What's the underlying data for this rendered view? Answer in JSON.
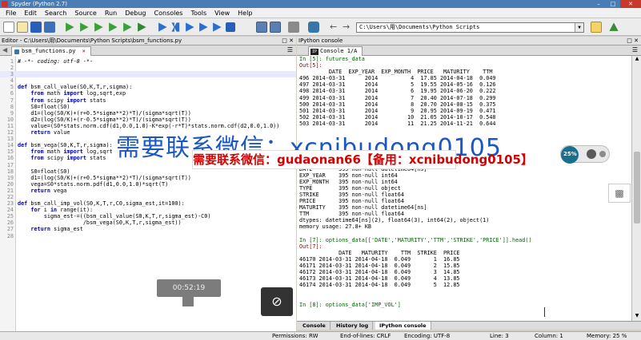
{
  "window": {
    "title": "Spyder (Python 2.7)"
  },
  "menu": [
    "File",
    "Edit",
    "Search",
    "Source",
    "Run",
    "Debug",
    "Consoles",
    "Tools",
    "View",
    "Help"
  ],
  "toolbar": {
    "path": "C:\\Users\\用\\Documents\\Python Scripts"
  },
  "editor": {
    "pane_title": "Editor - C:\\Users\\用\\Documents\\Python Scripts\\bsm_functions.py",
    "tab_label": "bsm_functions.py",
    "lines": [
      "# -*- coding: utf-8 -*-",
      "",
      "",
      "",
      "def bsm_call_value(S0,K,T,r,sigma):",
      "    from math import log,sqrt,exp",
      "    from scipy import stats",
      "    S0=float(S0)",
      "    d1=(log(S0/K)+(r+0.5*sigma**2)*T)/(sigma*sqrt(T))",
      "    d2=(log(S0/K)+(r-0.5*sigma**2)*T)/(sigma*sqrt(T))",
      "    value=(S0*stats.norm.cdf(d1,0.0,1.0)-K*exp(-r*T)*stats.norm.cdf(d2,0.0,1.0))",
      "    return value",
      "",
      "def bsm_vega(S0,K,T,r,sigma):",
      "    from math import log,sqrt",
      "    from scipy import stats",
      "",
      "    S0=float(S0)",
      "    d1=(log(S0/K)+(r+0.5*sigma**2)*T)/(sigma*sqrt(T))",
      "    vega=S0*stats.norm.pdf(d1,0.0,1.0)*sqrt(T)",
      "    return vega",
      "",
      "def bsm_call_imp_vol(S0,K,T,r,C0,sigma_est,it=100):",
      "    for i in range(it):",
      "        sigma_est-=((bsm_call_value(S0,K,T,r,sigma_est)-C0)",
      "                    /bsm_vega(S0,K,T,r,sigma_est))",
      "    return sigma_est",
      ""
    ]
  },
  "console": {
    "pane_title": "IPython console",
    "tab_label": "Console 1/A",
    "lines": [
      "In [5]: futures_data",
      "Out[5]:",
      "         DATE  EXP_YEAR  EXP_MONTH  PRICE   MATURITY    TTM",
      "496 2014-03-31      2014          4  17.85 2014-04-18  0.049",
      "497 2014-03-31      2014          5  19.55 2014-05-16  0.126",
      "498 2014-03-31      2014          6  19.95 2014-06-20  0.222",
      "499 2014-03-31      2014          7  20.40 2014-07-18  0.299",
      "500 2014-03-31      2014          8  20.70 2014-08-15  0.375",
      "501 2014-03-31      2014          9  20.95 2014-09-19  0.471",
      "502 2014-03-31      2014         10  21.05 2014-10-17  0.548",
      "503 2014-03-31      2014         11  21.25 2014-11-21  0.644",
      "",
      "",
      "",
      "",
      "",
      "",
      "DATE        395 non-null datetime64[ns]",
      "EXP_YEAR    395 non-null int64",
      "EXP_MONTH   395 non-null int64",
      "TYPE        395 non-null object",
      "STRIKE      395 non-null float64",
      "PRICE       395 non-null float64",
      "MATURITY    395 non-null datetime64[ns]",
      "TTM         395 non-null float64",
      "dtypes: datetime64[ns](2), float64(3), int64(2), object(1)",
      "memory usage: 27.8+ KB",
      "",
      "In [7]: options_data[['DATE','MATURITY','TTM','STRIKE','PRICE']].head()",
      "Out[7]:",
      "            DATE   MATURITY    TTM  STRIKE  PRICE",
      "46170 2014-03-31 2014-04-18  0.049       1  16.85",
      "46171 2014-03-31 2014-04-18  0.049       2  15.85",
      "46172 2014-03-31 2014-04-18  0.049       3  14.85",
      "46173 2014-03-31 2014-04-18  0.049       4  13.85",
      "46174 2014-03-31 2014-04-18  0.049       5  12.85",
      "",
      "",
      "In [8]: options_data['IMP_VOL']"
    ],
    "bottom_tabs": [
      "Console",
      "History log",
      "IPython console"
    ]
  },
  "watermark": {
    "big_text": "需要联系微信：xcnibudong0105",
    "banner_text": "需要联系微信：gudaonan66【备用：xcnibudong0105】"
  },
  "video": {
    "time": "00:52:19"
  },
  "gauge": {
    "percent": "25%"
  },
  "status": {
    "permissions_label": "Permissions:",
    "permissions": "RW",
    "eol_label": "End-of-lines:",
    "eol": "CRLF",
    "encoding_label": "Encoding:",
    "encoding": "UTF-8",
    "line_label": "Line:",
    "line": "3",
    "column_label": "Column:",
    "column": "1",
    "memory_label": "Memory:",
    "memory": "25 %"
  }
}
